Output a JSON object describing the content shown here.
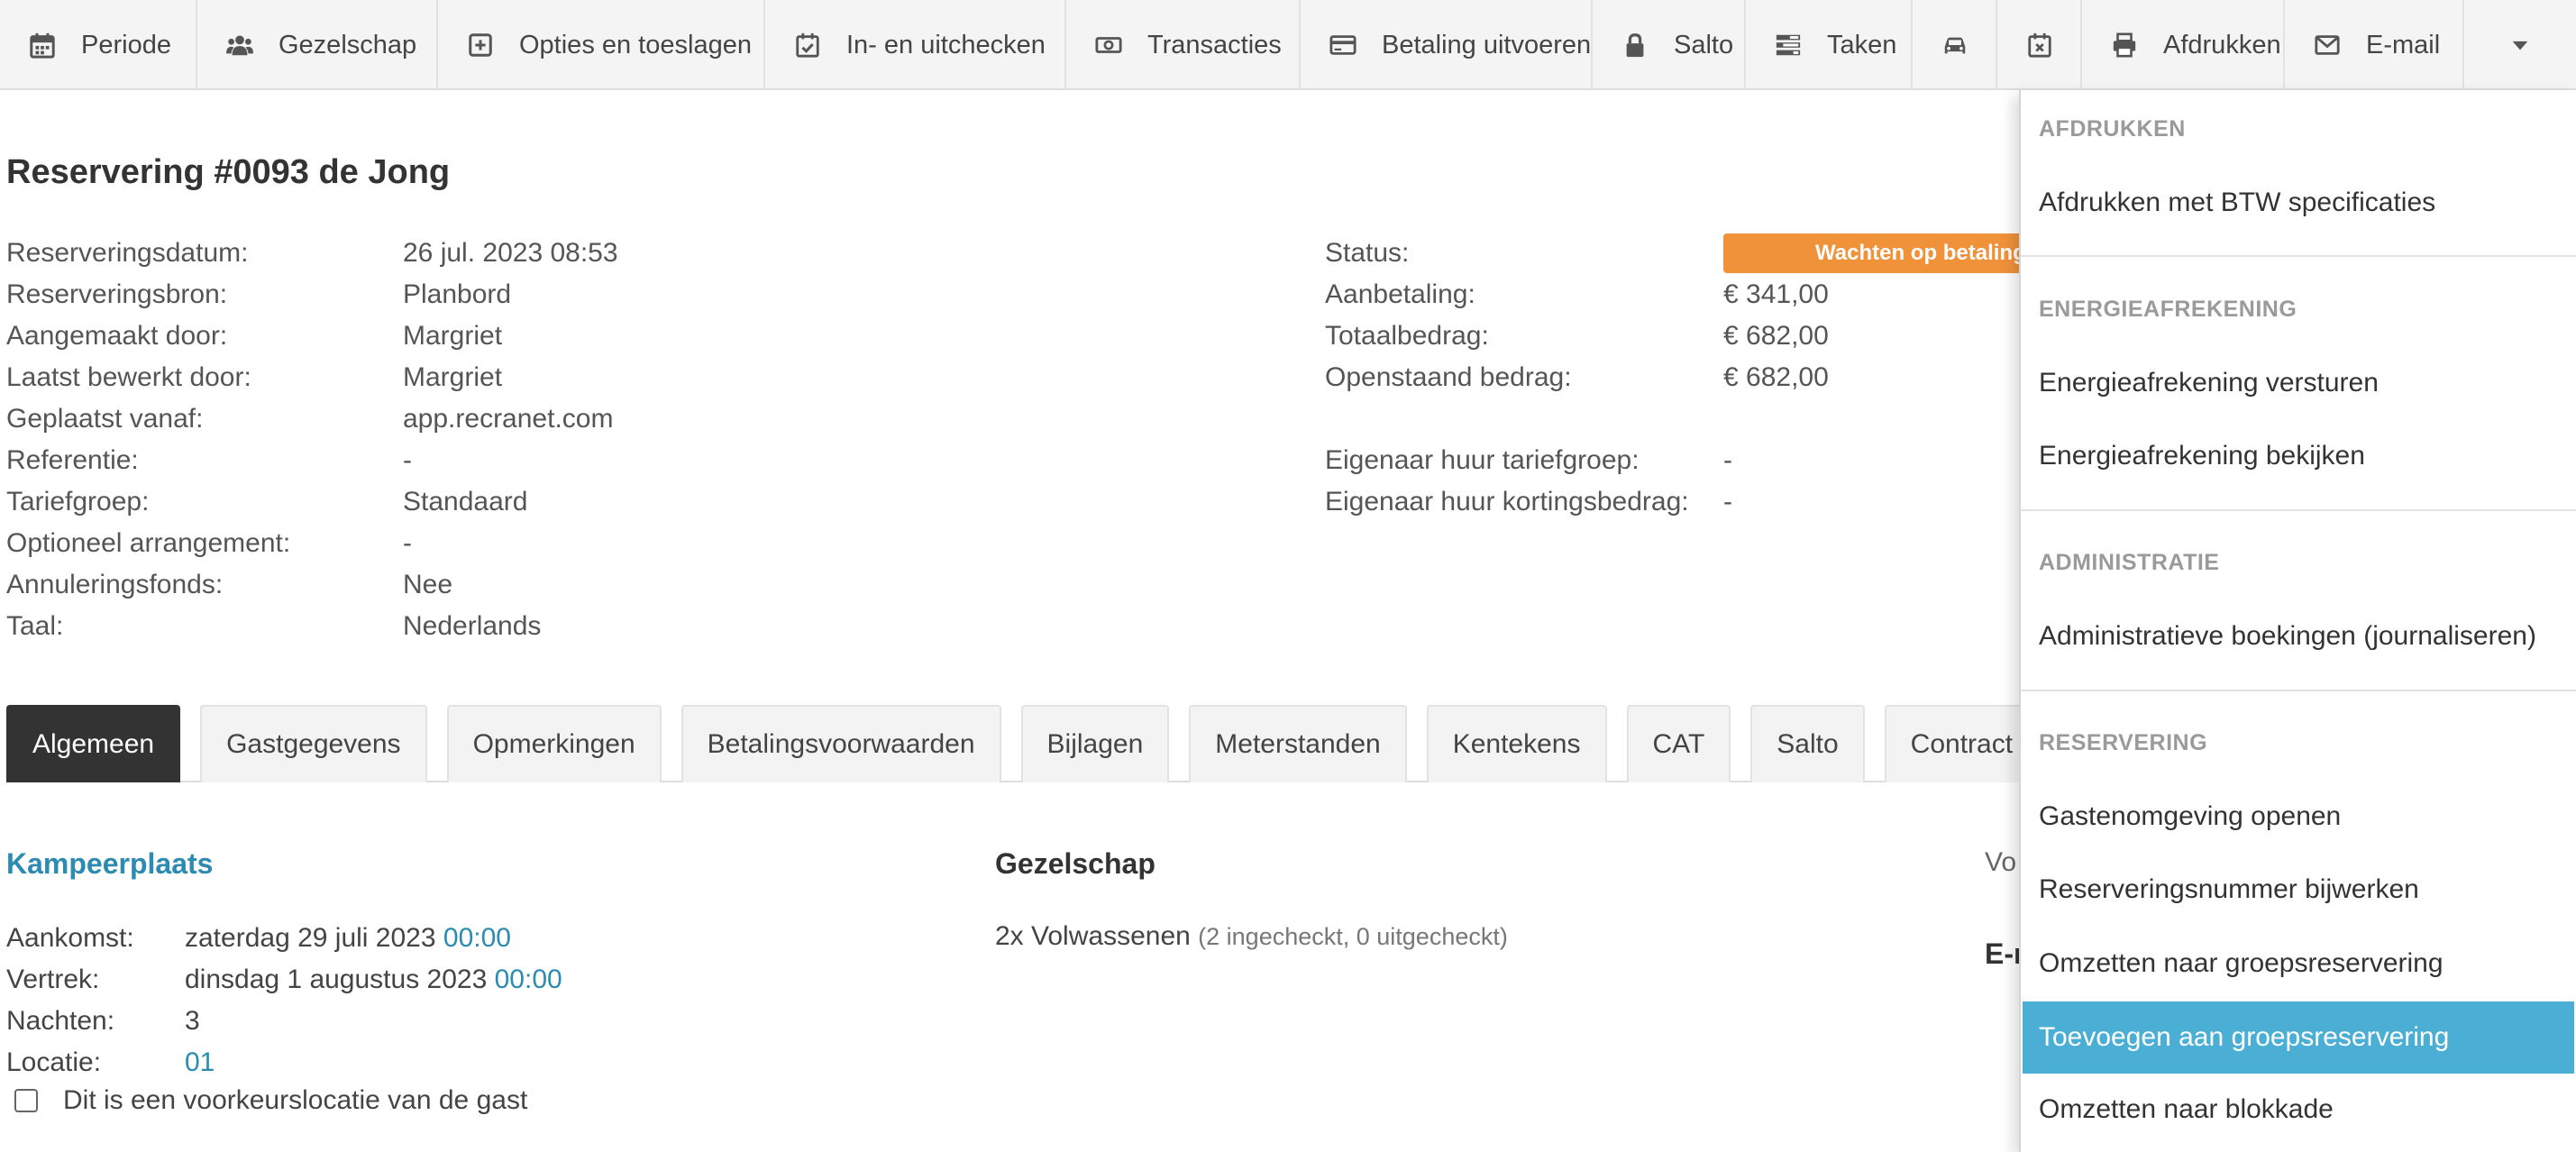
{
  "toolbar": {
    "items": [
      {
        "label": "Periode",
        "icon": "calendar-icon"
      },
      {
        "label": "Gezelschap",
        "icon": "users-icon"
      },
      {
        "label": "Opties en toeslagen",
        "icon": "plus-square-icon"
      },
      {
        "label": "In- en uitchecken",
        "icon": "calendar-check-icon"
      },
      {
        "label": "Transacties",
        "icon": "money-icon"
      },
      {
        "label": "Betaling uitvoeren",
        "icon": "credit-card-icon"
      },
      {
        "label": "Salto",
        "icon": "lock-icon"
      },
      {
        "label": "Taken",
        "icon": "tasks-icon"
      },
      {
        "label": "",
        "icon": "car-icon"
      },
      {
        "label": "",
        "icon": "calendar-times-icon"
      },
      {
        "label": "Afdrukken",
        "icon": "print-icon"
      },
      {
        "label": "E-mail",
        "icon": "envelope-icon"
      }
    ]
  },
  "reservation": {
    "title": "Reservering #0093 de Jong",
    "details_left": [
      {
        "label": "Reserveringsdatum:",
        "value": "26 jul. 2023 08:53"
      },
      {
        "label": "Reserveringsbron:",
        "value": "Planbord"
      },
      {
        "label": "Aangemaakt door:",
        "value": "Margriet"
      },
      {
        "label": "Laatst bewerkt door:",
        "value": "Margriet"
      },
      {
        "label": "Geplaatst vanaf:",
        "value": "app.recranet.com"
      },
      {
        "label": "Referentie:",
        "value": "-"
      },
      {
        "label": "Tariefgroep:",
        "value": "Standaard"
      },
      {
        "label": "Optioneel arrangement:",
        "value": "-"
      },
      {
        "label": "Annuleringsfonds:",
        "value": "Nee"
      },
      {
        "label": "Taal:",
        "value": "Nederlands"
      }
    ],
    "status_label": "Status:",
    "status_value": "Wachten op betaling",
    "status_color": "#f0923a",
    "amounts": [
      {
        "label": "Aanbetaling:",
        "value": "€ 341,00"
      },
      {
        "label": "Totaalbedrag:",
        "value": "€ 682,00"
      },
      {
        "label": "Openstaand bedrag:",
        "value": "€ 682,00"
      }
    ],
    "owner": [
      {
        "label": "Eigenaar huur tariefgroep:",
        "value": "-"
      },
      {
        "label": "Eigenaar huur kortingsbedrag:",
        "value": "-"
      }
    ]
  },
  "tabs": [
    {
      "label": "Algemeen",
      "active": true
    },
    {
      "label": "Gastgegevens"
    },
    {
      "label": "Opmerkingen"
    },
    {
      "label": "Betalingsvoorwaarden"
    },
    {
      "label": "Bijlagen"
    },
    {
      "label": "Meterstanden"
    },
    {
      "label": "Kentekens"
    },
    {
      "label": "CAT"
    },
    {
      "label": "Salto"
    },
    {
      "label": "Contract"
    }
  ],
  "camping": {
    "title": "Kampeerplaats",
    "arrival_label": "Aankomst:",
    "arrival_date": "zaterdag 29 juli 2023",
    "arrival_time": "00:00",
    "departure_label": "Vertrek:",
    "departure_date": "dinsdag 1 augustus 2023",
    "departure_time": "00:00",
    "nights_label": "Nachten:",
    "nights": "3",
    "location_label": "Locatie:",
    "location": "01",
    "preferred_checkbox_label": "Dit is een voorkeurslocatie van de gast",
    "preferred_checked": false
  },
  "party": {
    "title": "Gezelschap",
    "summary": "2x Volwassenen",
    "detail": "(2 ingecheckt, 0 uitgecheckt)"
  },
  "peek": {
    "text1": "Vo",
    "text2": "E-r"
  },
  "dropdown": {
    "sections": [
      {
        "header": "Afdrukken",
        "items": [
          "Afdrukken met BTW specificaties"
        ]
      },
      {
        "header": "Energieafrekening",
        "items": [
          "Energieafrekening versturen",
          "Energieafrekening bekijken"
        ]
      },
      {
        "header": "Administratie",
        "items": [
          "Administratieve boekingen (journaliseren)"
        ]
      },
      {
        "header": "Reservering",
        "items": [
          "Gastenomgeving openen",
          "Reserveringsnummer bijwerken",
          "Omzetten naar groepsreservering",
          "Toevoegen aan groepsreservering",
          "Omzetten naar blokkade"
        ]
      }
    ],
    "highlighted_item": "Toevoegen aan groepsreservering",
    "highlight_color": "#4aaed5"
  }
}
